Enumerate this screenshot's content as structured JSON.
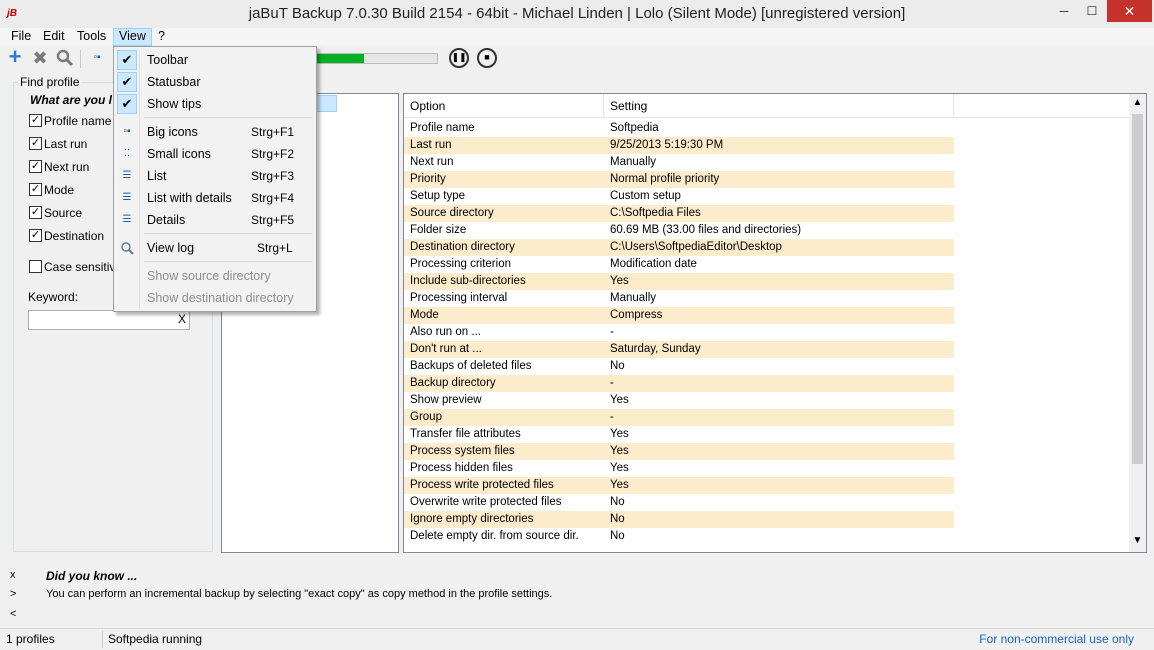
{
  "window": {
    "title": "jaBuT Backup 7.0.30 Build 2154 - 64bit - Michael Linden     |     Lolo (Silent Mode) [unregistered version]",
    "icon_text": "jB",
    "controls": {
      "minimize": "─",
      "maximize": "☐",
      "close": "✕"
    }
  },
  "menubar": [
    {
      "label": "File"
    },
    {
      "label": "Edit"
    },
    {
      "label": "Tools"
    },
    {
      "label": "View"
    },
    {
      "label": "?"
    }
  ],
  "toolbar": {
    "icons": [
      "add-icon",
      "delete-icon",
      "search-icon",
      "big-icons-icon"
    ],
    "progress_fraction": 0.42,
    "pause_glyph": "❚❚",
    "stop_glyph": "■"
  },
  "find_panel": {
    "legend": "Find profile",
    "subtitle": "What are you l",
    "checkboxes": [
      {
        "label": "Profile name",
        "checked": true
      },
      {
        "label": "Last run",
        "checked": true
      },
      {
        "label": "Next run",
        "checked": true
      },
      {
        "label": "Mode",
        "checked": true
      },
      {
        "label": "Source",
        "checked": true
      },
      {
        "label": "Destination",
        "checked": true
      },
      {
        "label": "Case sensitive",
        "checked": false
      }
    ],
    "keyword_label": "Keyword:",
    "keyword_value": "",
    "keyword_clear": "X"
  },
  "detail": {
    "headers": {
      "option": "Option",
      "setting": "Setting"
    },
    "rows": [
      [
        "Profile name",
        "Softpedia"
      ],
      [
        "Last run",
        "9/25/2013 5:19:30 PM"
      ],
      [
        "Next run",
        "Manually"
      ],
      [
        "Priority",
        "Normal profile priority"
      ],
      [
        "Setup type",
        "Custom setup"
      ],
      [
        "Source directory",
        "C:\\Softpedia Files"
      ],
      [
        "Folder size",
        "60.69 MB (33.00 files and directories)"
      ],
      [
        "Destination directory",
        "C:\\Users\\SoftpediaEditor\\Desktop"
      ],
      [
        "Processing criterion",
        "Modification date"
      ],
      [
        "Include sub-directories",
        "Yes"
      ],
      [
        "Processing interval",
        "Manually"
      ],
      [
        "Mode",
        "Compress"
      ],
      [
        "Also run on ...",
        "-"
      ],
      [
        "Don't run at ...",
        "Saturday, Sunday"
      ],
      [
        "Backups of deleted files",
        "No"
      ],
      [
        "Backup directory",
        "-"
      ],
      [
        "Show preview",
        "Yes"
      ],
      [
        "Group",
        "-"
      ],
      [
        "Transfer file attributes",
        "Yes"
      ],
      [
        "Process system files",
        "Yes"
      ],
      [
        "Process hidden files",
        "Yes"
      ],
      [
        "Process write protected files",
        "Yes"
      ],
      [
        "Overwrite write protected files",
        "No"
      ],
      [
        "Ignore empty directories",
        "No"
      ],
      [
        "Delete empty dir. from source dir.",
        "No"
      ]
    ],
    "scroll_up": "▲",
    "scroll_down": "▼"
  },
  "tips": {
    "nav": [
      "x",
      ">",
      "<"
    ],
    "title": "Did you know ...",
    "text": "You can perform an incremental backup by selecting \"exact copy\" as copy method in the profile settings."
  },
  "statusbar": {
    "profiles": "1 profiles",
    "status": "Softpedia running",
    "note": "For non-commercial use only"
  },
  "view_menu": {
    "items": [
      {
        "label": "Toolbar",
        "shortcut": "",
        "checked": true
      },
      {
        "label": "Statusbar",
        "shortcut": "",
        "checked": true
      },
      {
        "label": "Show tips",
        "shortcut": "",
        "checked": true
      },
      {
        "label": "Big icons",
        "shortcut": "Strg+F1",
        "icon": "big-icons-icon"
      },
      {
        "label": "Small icons",
        "shortcut": "Strg+F2",
        "icon": "small-icons-icon"
      },
      {
        "label": "List",
        "shortcut": "Strg+F3",
        "icon": "list-icon"
      },
      {
        "label": "List with details",
        "shortcut": "Strg+F4",
        "icon": "list-details-icon"
      },
      {
        "label": "Details",
        "shortcut": "Strg+F5",
        "icon": "details-icon"
      },
      {
        "label": "View log",
        "shortcut": "Strg+L",
        "icon": "view-log-icon"
      },
      {
        "label": "Show source directory",
        "shortcut": "",
        "disabled": true
      },
      {
        "label": "Show destination directory",
        "shortcut": "",
        "disabled": true
      }
    ]
  },
  "colors": {
    "row_alt": "#fdeccc",
    "progress": "#06b025",
    "menu_highlight": "#cce8ff",
    "close_button": "#c7312b",
    "status_note": "#1464c8"
  }
}
